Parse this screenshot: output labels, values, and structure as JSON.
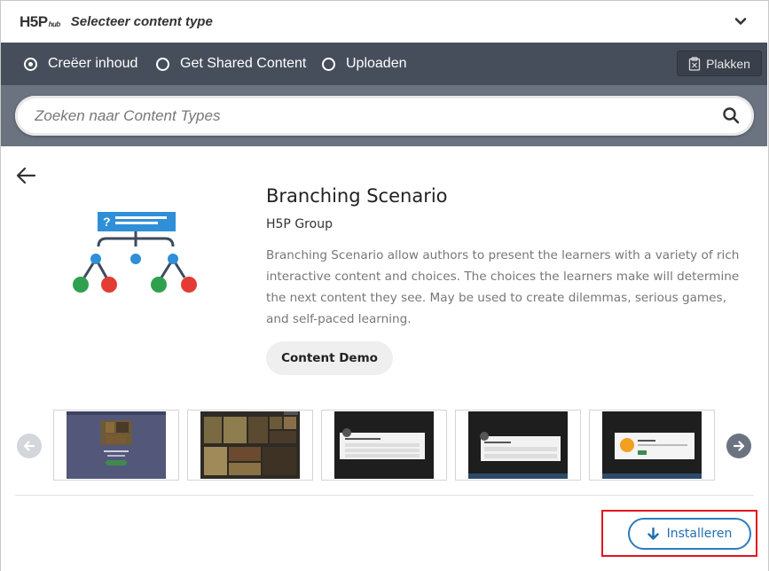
{
  "header": {
    "logo_main": "H5P",
    "logo_sub": "hub",
    "title": "Selecteer content type",
    "toggle_icon": "chevron-down-icon"
  },
  "tabs": [
    {
      "label": "Creëer inhoud",
      "selected": true
    },
    {
      "label": "Get Shared Content",
      "selected": false
    },
    {
      "label": "Uploaden",
      "selected": false
    }
  ],
  "paste": {
    "label": "Plakken",
    "icon": "clipboard-icon"
  },
  "search": {
    "placeholder": "Zoeken naar Content Types",
    "value": "",
    "icon": "search-icon"
  },
  "detail": {
    "title": "Branching Scenario",
    "owner": "H5P Group",
    "description": "Branching Scenario allow authors to present the learners with a variety of rich interactive content and choices. The choices the learners make will determine the next content they see. May be used to create dilemmas, serious games, and self-paced learning.",
    "demo_label": "Content Demo",
    "icon": "branching-scenario-icon"
  },
  "carousel": {
    "prev_icon": "arrow-left-icon",
    "next_icon": "arrow-right-icon",
    "thumbnails": [
      "screenshot-1",
      "screenshot-2",
      "screenshot-3",
      "screenshot-4",
      "screenshot-5"
    ]
  },
  "install": {
    "label": "Installeren",
    "icon": "download-arrow-icon"
  },
  "colors": {
    "tabs_bg": "#474e5b",
    "search_bg": "#6b7280",
    "accent_blue": "#1f6fb2",
    "highlight_red": "#e1141f"
  }
}
